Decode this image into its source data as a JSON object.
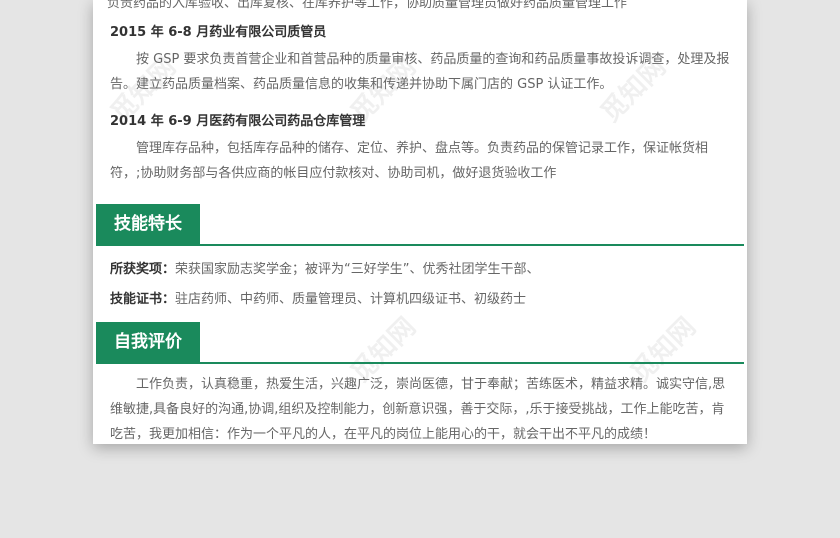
{
  "watermark": "觅知网",
  "experience": {
    "cut_line": "负责药品的入库验收、出库复核、在库养护等工作，协助质量管理员做好药品质量管理工作",
    "jobs": [
      {
        "title": "2015 年 6-8 月药业有限公司质管员",
        "desc": "按 GSP 要求负责首营企业和首营品种的质量审核、药品质量的查询和药品质量事故投诉调查，处理及报告。建立药品质量档案、药品质量信息的收集和传递并协助下属门店的 GSP 认证工作。"
      },
      {
        "title": "2014 年 6-9 月医药有限公司药品仓库管理",
        "desc": "管理库存品种，包括库存品种的储存、定位、养护、盘点等。负责药品的保管记录工作，保证帐货相符，;协助财务部与各供应商的帐目应付款核对、协助司机，做好退货验收工作"
      }
    ]
  },
  "skills": {
    "heading": "技能特长",
    "awards_label": "所获奖项：",
    "awards_value": "荣获国家励志奖学金；被评为“三好学生”、优秀社团学生干部、",
    "certs_label": "技能证书：",
    "certs_value": "驻店药师、中药师、质量管理员、计算机四级证书、初级药士"
  },
  "self_eval": {
    "heading": "自我评价",
    "text": "工作负责，认真稳重，热爱生活，兴趣广泛，崇尚医德，甘于奉献；苦练医术，精益求精。诚实守信,思维敏捷,具备良好的沟通,协调,组织及控制能力，创新意识强，善于交际，,乐于接受挑战，工作上能吃苦，肯吃苦，我更加相信：作为一个平凡的人，在平凡的岗位上能用心的干，就会干出不平凡的成绩！"
  },
  "colors": {
    "accent": "#1a8a5c",
    "background": "#e5e5e5",
    "paper": "#ffffff"
  }
}
